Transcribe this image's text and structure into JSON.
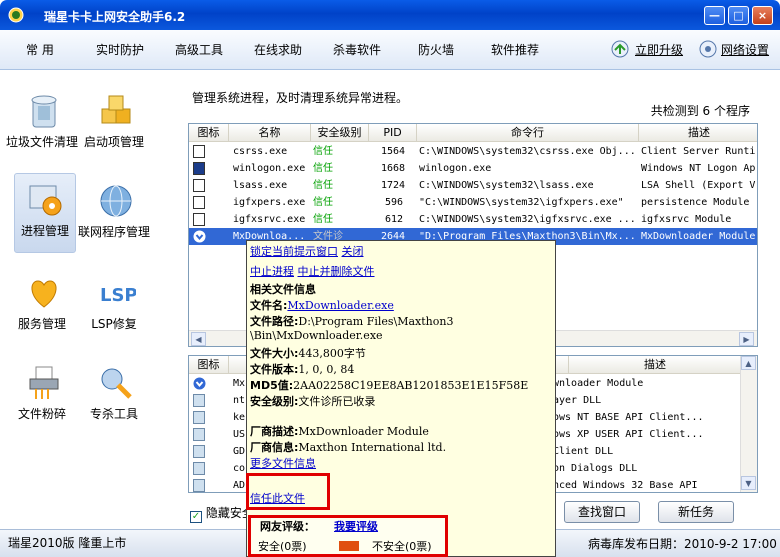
{
  "window": {
    "title": "瑞星卡卡上网安全助手6.2",
    "min": "—",
    "max": "□",
    "close": "×"
  },
  "menu": {
    "items": [
      "常 用",
      "实时防护",
      "高级工具",
      "在线求助",
      "杀毒软件",
      "防火墙",
      "软件推荐"
    ],
    "upgrade": "立即升级",
    "netset": "网络设置"
  },
  "sidebar": [
    {
      "label": "垃圾文件清理",
      "icon": "trash-bin-icon"
    },
    {
      "label": "启动项管理",
      "icon": "startup-blocks-icon"
    },
    {
      "label": "进程管理",
      "icon": "process-gear-icon"
    },
    {
      "label": "联网程序管理",
      "icon": "globe-icon"
    },
    {
      "label": "服务管理",
      "icon": "heart-service-icon"
    },
    {
      "label": "LSP修复",
      "icon": "lsp-repair-icon"
    },
    {
      "label": "文件粉碎",
      "icon": "shredder-icon"
    },
    {
      "label": "专杀工具",
      "icon": "wrench-icon"
    }
  ],
  "main": {
    "description": "管理系统进程，及时清理系统异常进程。",
    "count": "共检测到 6 个程序",
    "columns": [
      "图标",
      "名称",
      "安全级别",
      "PID",
      "命令行",
      "描述"
    ],
    "rows": [
      {
        "name": "csrss.exe",
        "level": "信任",
        "pid": "1564",
        "cmd": "C:\\WINDOWS\\system32\\csrss.exe Obj...",
        "desc": "Client Server Runti"
      },
      {
        "name": "winlogon.exe",
        "level": "信任",
        "pid": "1668",
        "cmd": "winlogon.exe",
        "desc": "Windows NT Logon Ap"
      },
      {
        "name": "lsass.exe",
        "level": "信任",
        "pid": "1724",
        "cmd": "C:\\WINDOWS\\system32\\lsass.exe",
        "desc": "LSA Shell (Export V"
      },
      {
        "name": "igfxpers.exe",
        "level": "信任",
        "pid": "596",
        "cmd": "\"C:\\WINDOWS\\system32\\igfxpers.exe\"",
        "desc": "persistence Module"
      },
      {
        "name": "igfxsrvc.exe",
        "level": "信任",
        "pid": "612",
        "cmd": "C:\\WINDOWS\\system32\\igfxsrvc.exe ...",
        "desc": "igfxsrvc Module"
      },
      {
        "name": "MxDownloa...",
        "level": "文件诊",
        "pid": "2644",
        "cmd": "\"D:\\Program Files\\Maxthon3\\Bin\\Mx...",
        "desc": "MxDownloader Module"
      }
    ],
    "columns2": [
      "图标",
      "描述"
    ],
    "rows2": [
      {
        "name": "Mx",
        "desc": "wnloader Module"
      },
      {
        "name": "nt",
        "desc": "ayer DLL"
      },
      {
        "name": "ke",
        "desc": "ows NT BASE API Client..."
      },
      {
        "name": "US",
        "desc": "ows XP USER API Client..."
      },
      {
        "name": "GD",
        "desc": "Client DLL"
      },
      {
        "name": "co",
        "desc": "on Dialogs DLL"
      },
      {
        "name": "AD",
        "desc": "nced Windows 32 Base API"
      }
    ],
    "hide_label": "隐藏安全",
    "find_window": "查找窗口",
    "new_task": "新任务"
  },
  "tooltip": {
    "lock": "锁定当前提示窗口",
    "close": "关闭",
    "stop": "中止进程",
    "stop_delete": "中止并删除文件",
    "info_title": "相关文件信息",
    "filename_label": "文件名:",
    "filename": "MxDownloader.exe",
    "path_label": "文件路径:",
    "path1": "D:\\Program Files\\Maxthon3",
    "path2": "\\Bin\\MxDownloader.exe",
    "size_label": "文件大小:",
    "size": "443,800字节",
    "version_label": "文件版本:",
    "version": "1, 0, 0, 84",
    "md5_label": "MD5值:",
    "md5": "2AA02258C19EE8AB1201853E1E15F58E",
    "level_label": "安全级别:",
    "level": "文件诊所已收录",
    "vendor_desc_label": "厂商描述:",
    "vendor_desc": "MxDownloader Module",
    "vendor_label": "厂商信息:",
    "vendor": "Maxthon International ltd.",
    "more": "更多文件信息",
    "trust": "信任此文件",
    "rating_label": "网友评级：",
    "rating_link": "我要评级",
    "safe_votes": "安全(0票)",
    "unsafe_votes": "不安全(0票)"
  },
  "status": {
    "left": "瑞星2010版 隆重上市",
    "right": "病毒库发布日期：2010-9-2 17:00"
  },
  "colors": {
    "title_blue": "#0042c8",
    "safe_green": "#00a000",
    "select_blue": "#3168d5",
    "tooltip_bg": "#ffffe1",
    "highlight_red": "#e00000",
    "unsafe_bar": "#e05010"
  }
}
